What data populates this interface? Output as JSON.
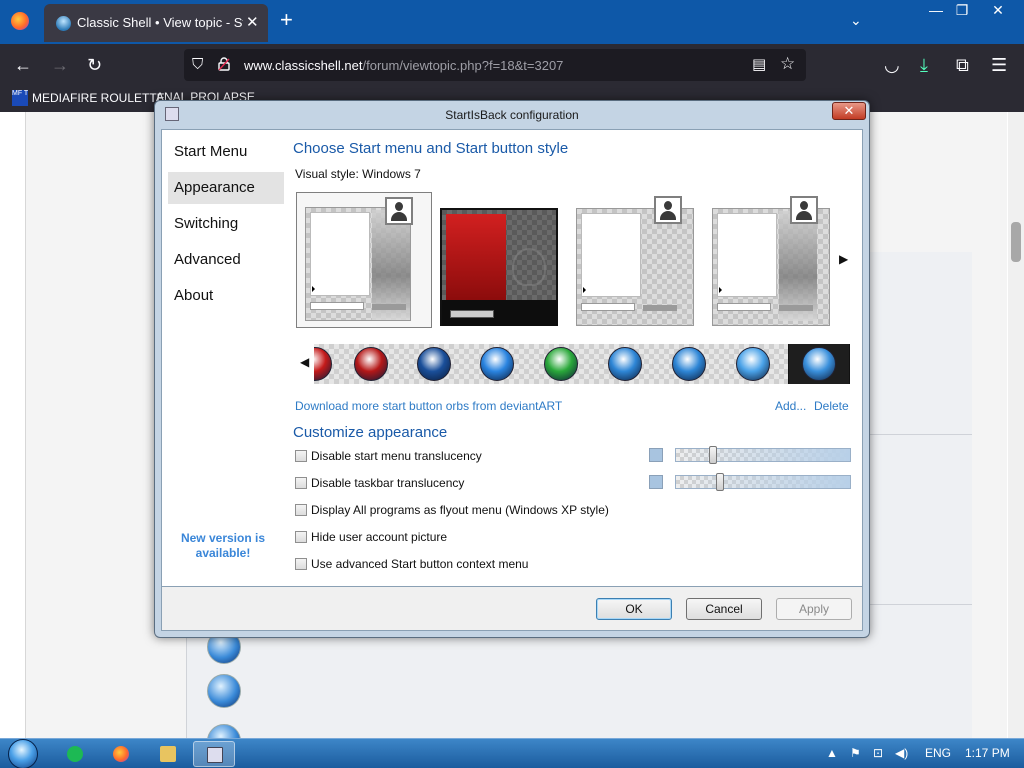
{
  "browser": {
    "tab_title": "Classic Shell • View topic - StartIsBack",
    "url_domain": "www.classicshell.net",
    "url_path": "/forum/viewtopic.php?f=18&t=3207",
    "bookmarks": [
      "MEDIAFIRE ROULETTE",
      "ANAL PROLAPSE"
    ],
    "mf_logo_text": "MF T",
    "icons": {
      "new_tab": "+",
      "tab_close": "✕",
      "tab_list": "⌄",
      "back": "←",
      "forward": "→",
      "reload": "↻",
      "shield": "⛉",
      "reader": "▤",
      "star": "☆",
      "pocket": "◡",
      "downloads": "⤓",
      "extensions": "⧉",
      "menu": "☰",
      "minimize": "—",
      "restore": "❐",
      "close": "✕"
    }
  },
  "dialog": {
    "title": "StartIsBack configuration",
    "close_glyph": "✕",
    "nav": [
      "Start Menu",
      "Appearance",
      "Switching",
      "Advanced",
      "About"
    ],
    "selected_nav": "Appearance",
    "new_version": "New version is available!",
    "style_heading": "Choose Start menu and Start button style",
    "visual_style_label": "Visual style:",
    "visual_style_value": "Windows 7",
    "carousel_prev": "◀",
    "carousel_next": "▶",
    "orbs": [
      {
        "name": "red-orb",
        "color": "#c41a1a"
      },
      {
        "name": "win8-red-orb",
        "color": "#b51818"
      },
      {
        "name": "win7-dark-orb",
        "color": "#1a4f9a"
      },
      {
        "name": "blue-orb",
        "color": "#2a84e0"
      },
      {
        "name": "clover-orb",
        "color": "#2aa83a"
      },
      {
        "name": "win7-orb-1",
        "color": "#2e86d6"
      },
      {
        "name": "win7-orb-2",
        "color": "#2e86d6"
      },
      {
        "name": "win7-orb-3",
        "color": "#4aa2e8"
      },
      {
        "name": "win7-orb-selected",
        "color": "#3a90dc"
      }
    ],
    "download_link": "Download more start button orbs from deviantART",
    "add_link": "Add...",
    "delete_link": "Delete",
    "customize_heading": "Customize appearance",
    "options": [
      "Disable start menu translucency",
      "Disable taskbar translucency",
      "Display All programs as flyout menu (Windows XP style)",
      "Hide user account picture",
      "Use advanced Start button context menu"
    ],
    "translucency_levels": [
      0.2,
      0.24
    ],
    "buttons": {
      "ok": "OK",
      "cancel": "Cancel",
      "apply": "Apply"
    }
  },
  "taskbar": {
    "language": "ENG",
    "time": "1:17 PM",
    "tray_arrow": "▲",
    "tray_icons": [
      "⚑",
      "⊡",
      "◀)"
    ]
  },
  "colors": {
    "accent_link": "#2e7bc6",
    "heading": "#1a5aa8",
    "titlebar": "#0e58a8"
  }
}
